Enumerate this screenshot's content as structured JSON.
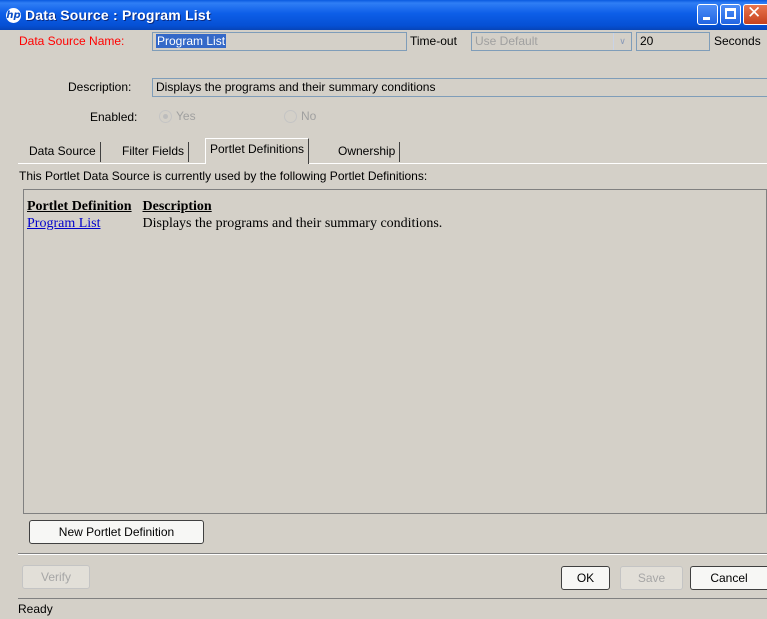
{
  "window": {
    "title": "Data Source : Program List"
  },
  "form": {
    "name_label": "Data Source Name:",
    "name_value": "Program List",
    "timeout_label": "Time-out",
    "timeout_value": "Use Default",
    "seconds_value": "20",
    "seconds_label": "Seconds",
    "description_label": "Description:",
    "description_value": "Displays the programs and their summary conditions",
    "enabled_label": "Enabled:",
    "enabled_yes": "Yes",
    "enabled_no": "No"
  },
  "tabs": [
    {
      "label": "Data Source"
    },
    {
      "label": "Filter Fields"
    },
    {
      "label": "Portlet Definitions"
    },
    {
      "label": "Ownership"
    }
  ],
  "portlet": {
    "info": "This Portlet Data Source is currently used by the following Portlet Definitions:",
    "columns": [
      "Portlet Definition",
      "Description"
    ],
    "rows": [
      {
        "name": "Program List",
        "description": "Displays the programs and their summary conditions."
      }
    ],
    "new_button": "New Portlet Definition"
  },
  "buttons": {
    "verify": "Verify",
    "ok": "OK",
    "save": "Save",
    "cancel": "Cancel"
  },
  "status": {
    "text": "Ready"
  },
  "colors": {
    "title_bar": "#0a5ae0",
    "label_required": "#ff0000",
    "selection": "#3569c8",
    "link": "#0000cc"
  }
}
